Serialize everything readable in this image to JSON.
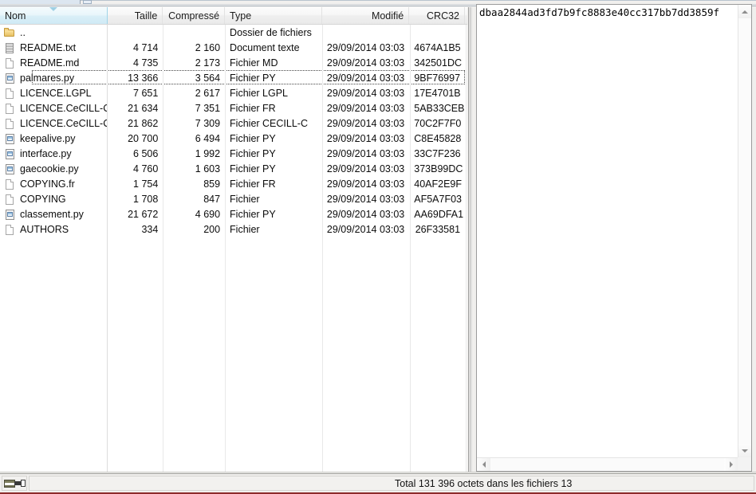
{
  "window": {
    "chrome_tab_label": "",
    "accent_sorted_header": "#cfeaf5",
    "status_underline_color": "#8d2b2b"
  },
  "filelist": {
    "columns": [
      {
        "key": "name",
        "label": "Nom",
        "align": "left",
        "sorted": true,
        "sort_dir": "desc"
      },
      {
        "key": "size",
        "label": "Taille",
        "align": "right",
        "sorted": false
      },
      {
        "key": "comp",
        "label": "Compressé",
        "align": "right",
        "sorted": false
      },
      {
        "key": "type",
        "label": "Type",
        "align": "left",
        "sorted": false
      },
      {
        "key": "mod",
        "label": "Modifié",
        "align": "right",
        "sorted": false
      },
      {
        "key": "crc",
        "label": "CRC32",
        "align": "right",
        "sorted": false
      }
    ],
    "rows": [
      {
        "icon": "folder-icon",
        "name": "..",
        "size": "",
        "comp": "",
        "type": "Dossier de fichiers",
        "mod": "",
        "crc": "",
        "focused": false
      },
      {
        "icon": "text-file-icon",
        "name": "README.txt",
        "size": "4 714",
        "comp": "2 160",
        "type": "Document texte",
        "mod": "29/09/2014 03:03",
        "crc": "4674A1B5",
        "focused": false
      },
      {
        "icon": "blank-file-icon",
        "name": "README.md",
        "size": "4 735",
        "comp": "2 173",
        "type": "Fichier MD",
        "mod": "29/09/2014 03:03",
        "crc": "342501DC",
        "focused": false
      },
      {
        "icon": "python-file-icon",
        "name": "palmares.py",
        "size": "13 366",
        "comp": "3 564",
        "type": "Fichier PY",
        "mod": "29/09/2014 03:03",
        "crc": "9BF76997",
        "focused": true
      },
      {
        "icon": "blank-file-icon",
        "name": "LICENCE.LGPL",
        "size": "7 651",
        "comp": "2 617",
        "type": "Fichier LGPL",
        "mod": "29/09/2014 03:03",
        "crc": "17E4701B",
        "focused": false
      },
      {
        "icon": "blank-file-icon",
        "name": "LICENCE.CeCILL-C.fr",
        "size": "21 634",
        "comp": "7 351",
        "type": "Fichier FR",
        "mod": "29/09/2014 03:03",
        "crc": "5AB33CEB",
        "focused": false
      },
      {
        "icon": "blank-file-icon",
        "name": "LICENCE.CeCILL-C",
        "size": "21 862",
        "comp": "7 309",
        "type": "Fichier CECILL-C",
        "mod": "29/09/2014 03:03",
        "crc": "70C2F7F0",
        "focused": false
      },
      {
        "icon": "python-file-icon",
        "name": "keepalive.py",
        "size": "20 700",
        "comp": "6 494",
        "type": "Fichier PY",
        "mod": "29/09/2014 03:03",
        "crc": "C8E45828",
        "focused": false
      },
      {
        "icon": "python-file-icon",
        "name": "interface.py",
        "size": "6 506",
        "comp": "1 992",
        "type": "Fichier PY",
        "mod": "29/09/2014 03:03",
        "crc": "33C7F236",
        "focused": false
      },
      {
        "icon": "python-file-icon",
        "name": "gaecookie.py",
        "size": "4 760",
        "comp": "1 603",
        "type": "Fichier PY",
        "mod": "29/09/2014 03:03",
        "crc": "373B99DC",
        "focused": false
      },
      {
        "icon": "blank-file-icon",
        "name": "COPYING.fr",
        "size": "1 754",
        "comp": "859",
        "type": "Fichier FR",
        "mod": "29/09/2014 03:03",
        "crc": "40AF2E9F",
        "focused": false
      },
      {
        "icon": "blank-file-icon",
        "name": "COPYING",
        "size": "1 708",
        "comp": "847",
        "type": "Fichier",
        "mod": "29/09/2014 03:03",
        "crc": "AF5A7F03",
        "focused": false
      },
      {
        "icon": "python-file-icon",
        "name": "classement.py",
        "size": "21 672",
        "comp": "4 690",
        "type": "Fichier PY",
        "mod": "29/09/2014 03:03",
        "crc": "AA69DFA1",
        "focused": false
      },
      {
        "icon": "blank-file-icon",
        "name": "AUTHORS",
        "size": "334",
        "comp": "200",
        "type": "Fichier",
        "mod": "29/09/2014 03:03",
        "crc": "26F33581",
        "focused": false
      }
    ]
  },
  "textpanel": {
    "content": "dbaa2844ad3fd7b9fc8883e40cc317bb7dd3859f",
    "vscroll_up_icon": "scroll-up-arrow-icon",
    "vscroll_down_icon": "scroll-down-arrow-icon",
    "hscroll_left_icon": "scroll-left-arrow-icon",
    "hscroll_right_icon": "scroll-right-arrow-icon"
  },
  "statusbar": {
    "icons": [
      {
        "name": "disk-icon"
      },
      {
        "name": "key-icon"
      }
    ],
    "info": "Total 131 396 octets dans les fichiers 13"
  }
}
